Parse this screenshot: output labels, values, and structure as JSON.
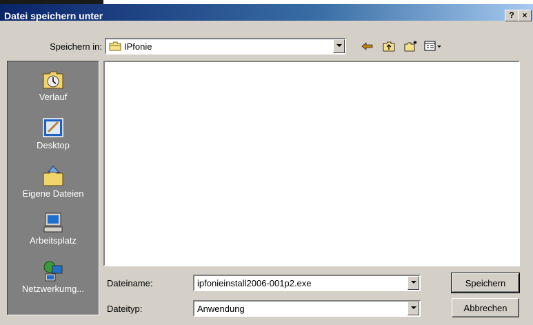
{
  "window": {
    "title": "Datei speichern unter"
  },
  "save_in": {
    "label": "Speichern in:",
    "value": "IPfonie"
  },
  "places": [
    {
      "label": "Verlauf",
      "icon": "history-icon"
    },
    {
      "label": "Desktop",
      "icon": "desktop-icon"
    },
    {
      "label": "Eigene Dateien",
      "icon": "my-documents-icon"
    },
    {
      "label": "Arbeitsplatz",
      "icon": "my-computer-icon"
    },
    {
      "label": "Netzwerkumg...",
      "icon": "network-icon"
    }
  ],
  "filename": {
    "label": "Dateiname:",
    "value": "ipfonieinstall2006-001p2.exe"
  },
  "filetype": {
    "label": "Dateityp:",
    "value": "Anwendung"
  },
  "buttons": {
    "save": "Speichern",
    "cancel": "Abbrechen",
    "help": "?",
    "close": "×"
  }
}
